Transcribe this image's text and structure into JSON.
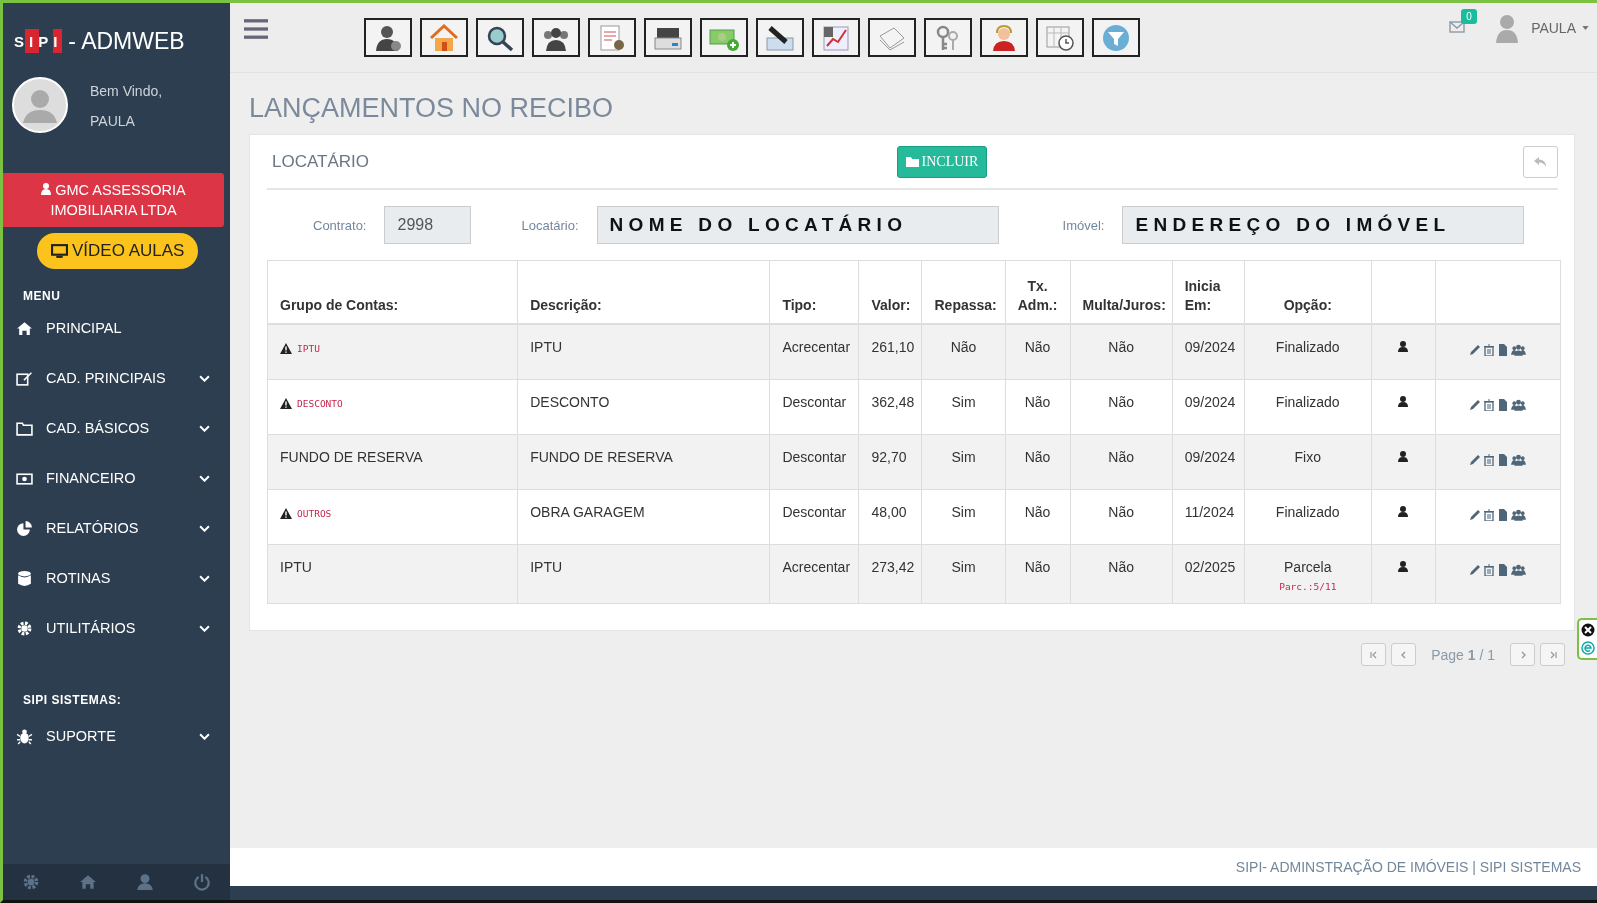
{
  "brand": {
    "logo": "SIPI",
    "name": "- ADMWEB"
  },
  "user": {
    "greeting": "Bem Vindo,",
    "name": "PAULA"
  },
  "company": "GMC ASSESSORIA IMOBILIARIA LTDA",
  "video_button": "VÍDEO AULAS",
  "menu": {
    "heading": "MENU",
    "items": [
      {
        "label": "PRINCIPAL",
        "kind": "home",
        "expandable": false
      },
      {
        "label": "CAD. PRINCIPAIS",
        "kind": "edit",
        "expandable": true
      },
      {
        "label": "CAD. BÁSICOS",
        "kind": "folder",
        "expandable": true
      },
      {
        "label": "FINANCEIRO",
        "kind": "money",
        "expandable": true
      },
      {
        "label": "RELATÓRIOS",
        "kind": "pie",
        "expandable": true
      },
      {
        "label": "ROTINAS",
        "kind": "database",
        "expandable": true
      },
      {
        "label": "UTILITÁRIOS",
        "kind": "gear",
        "expandable": true
      }
    ]
  },
  "systems": {
    "heading": "SIPI SISTEMAS:",
    "items": [
      {
        "label": "SUPORTE",
        "kind": "bug",
        "expandable": true
      }
    ]
  },
  "topbar": {
    "messages_count": "0",
    "user": "PAULA"
  },
  "page_title": "LANÇAMENTOS NO RECIBO",
  "card": {
    "title": "LOCATÁRIO",
    "add_button": "INCLUIR"
  },
  "filters": [
    {
      "label": "Contrato:",
      "value": "2998",
      "kind": "short"
    },
    {
      "label": "Locatário:",
      "value": "NOME DO LOCATÁRIO",
      "kind": "wide"
    },
    {
      "label": "Imóvel:",
      "value": "ENDEREÇO DO IMÓVEL",
      "kind": "wide"
    }
  ],
  "table": {
    "columns": [
      "Grupo de Contas:",
      "Descrição:",
      "Tipo:",
      "Valor:",
      "Repassa:",
      "Tx. Adm.:",
      "Multa/Juros:",
      "Inicia Em:",
      "Opção:"
    ],
    "rows": [
      {
        "group": "IPTU",
        "warning": true,
        "description": "IPTU",
        "type": "Acrecentar",
        "value": "261,10",
        "repassa": "Não",
        "tx_adm": "Não",
        "multa_juros": "Não",
        "start": "09/2024",
        "option": "Finalizado"
      },
      {
        "group": "DESCONTO",
        "warning": true,
        "description": "DESCONTO",
        "type": "Descontar",
        "value": "362,48",
        "repassa": "Sim",
        "tx_adm": "Não",
        "multa_juros": "Não",
        "start": "09/2024",
        "option": "Finalizado"
      },
      {
        "group": "FUNDO DE RESERVA",
        "warning": false,
        "description": "FUNDO DE RESERVA",
        "type": "Descontar",
        "value": "92,70",
        "repassa": "Sim",
        "tx_adm": "Não",
        "multa_juros": "Não",
        "start": "09/2024",
        "option": "Fixo"
      },
      {
        "group": "OUTROS",
        "warning": true,
        "description": "OBRA GARAGEM",
        "type": "Descontar",
        "value": "48,00",
        "repassa": "Sim",
        "tx_adm": "Não",
        "multa_juros": "Não",
        "start": "11/2024",
        "option": "Finalizado"
      },
      {
        "group": "IPTU",
        "warning": false,
        "description": "IPTU",
        "type": "Acrecentar",
        "value": "273,42",
        "repassa": "Sim",
        "tx_adm": "Não",
        "multa_juros": "Não",
        "start": "02/2025",
        "option": "Parcela",
        "option_note": "Parc.:5/11"
      }
    ]
  },
  "pagination": "Page **1** / 1",
  "footer": "SIPI- ADMINSTRAÇÃO DE IMÓVEIS | SIPI SISTEMAS"
}
